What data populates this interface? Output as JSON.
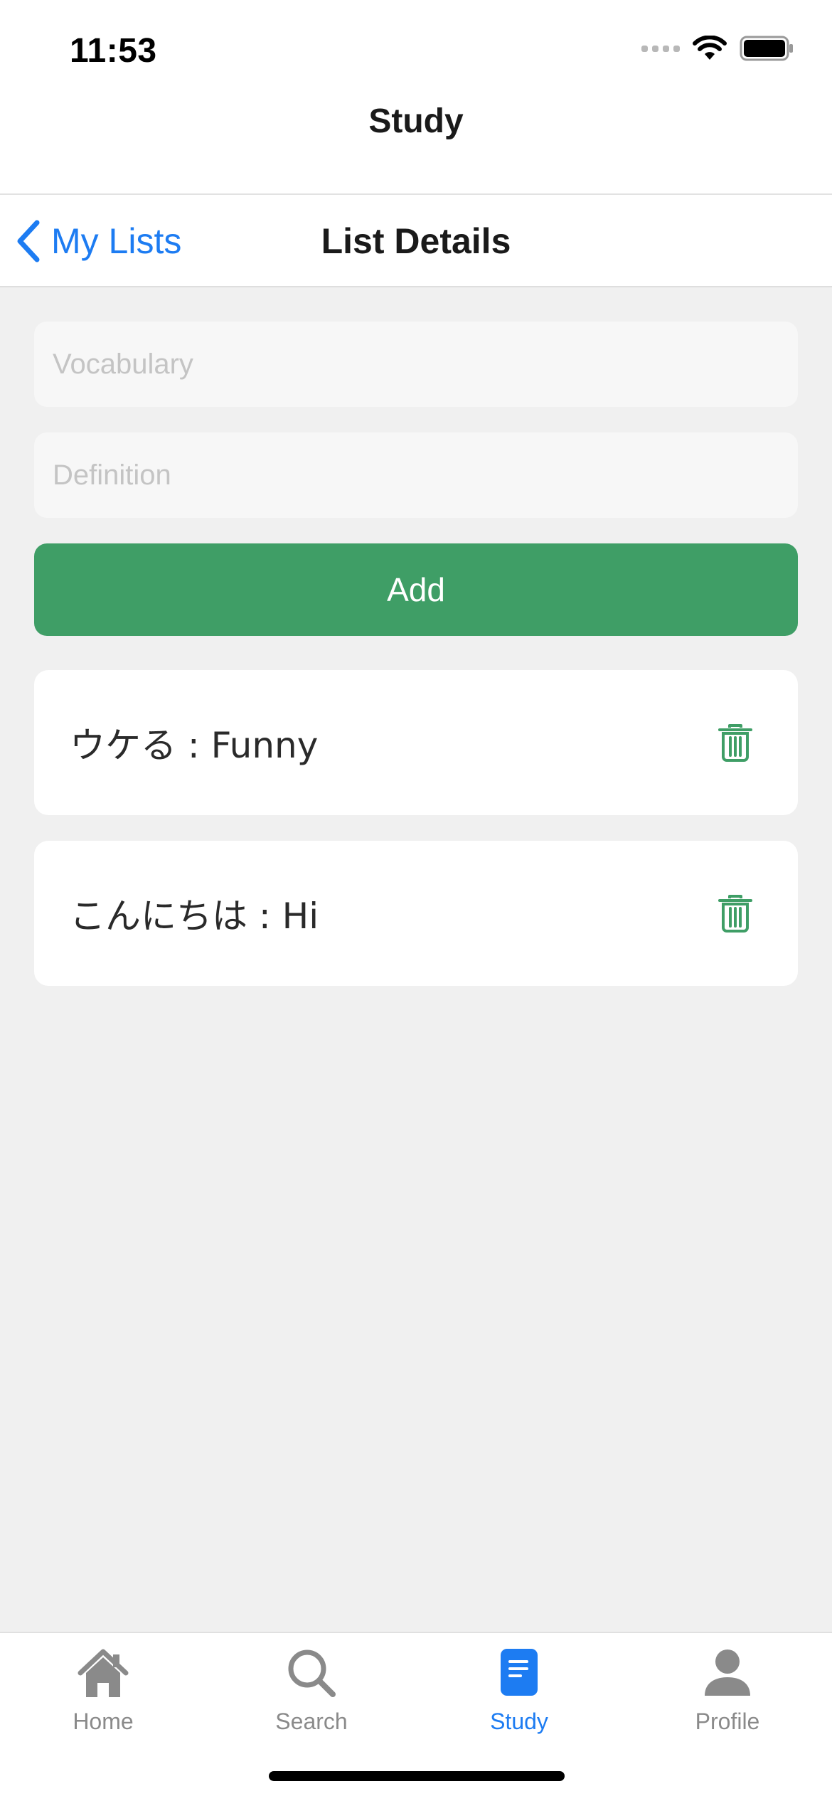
{
  "status_bar": {
    "time": "11:53"
  },
  "header": {
    "title": "Study"
  },
  "nav": {
    "back_label": "My Lists",
    "title": "List Details"
  },
  "form": {
    "vocabulary_placeholder": "Vocabulary",
    "vocabulary_value": "",
    "definition_placeholder": "Definition",
    "definition_value": "",
    "add_label": "Add"
  },
  "words": [
    {
      "text": "ウケる : Funny"
    },
    {
      "text": "こんにちは : Hi"
    }
  ],
  "tabs": [
    {
      "label": "Home",
      "icon": "home-icon"
    },
    {
      "label": "Search",
      "icon": "search-icon"
    },
    {
      "label": "Study",
      "icon": "study-icon",
      "active": true
    },
    {
      "label": "Profile",
      "icon": "profile-icon"
    }
  ],
  "colors": {
    "accent_blue": "#1d7cf2",
    "add_green": "#3f9e66",
    "background": "#f0f0f0",
    "tab_inactive": "#8a8a8a"
  }
}
